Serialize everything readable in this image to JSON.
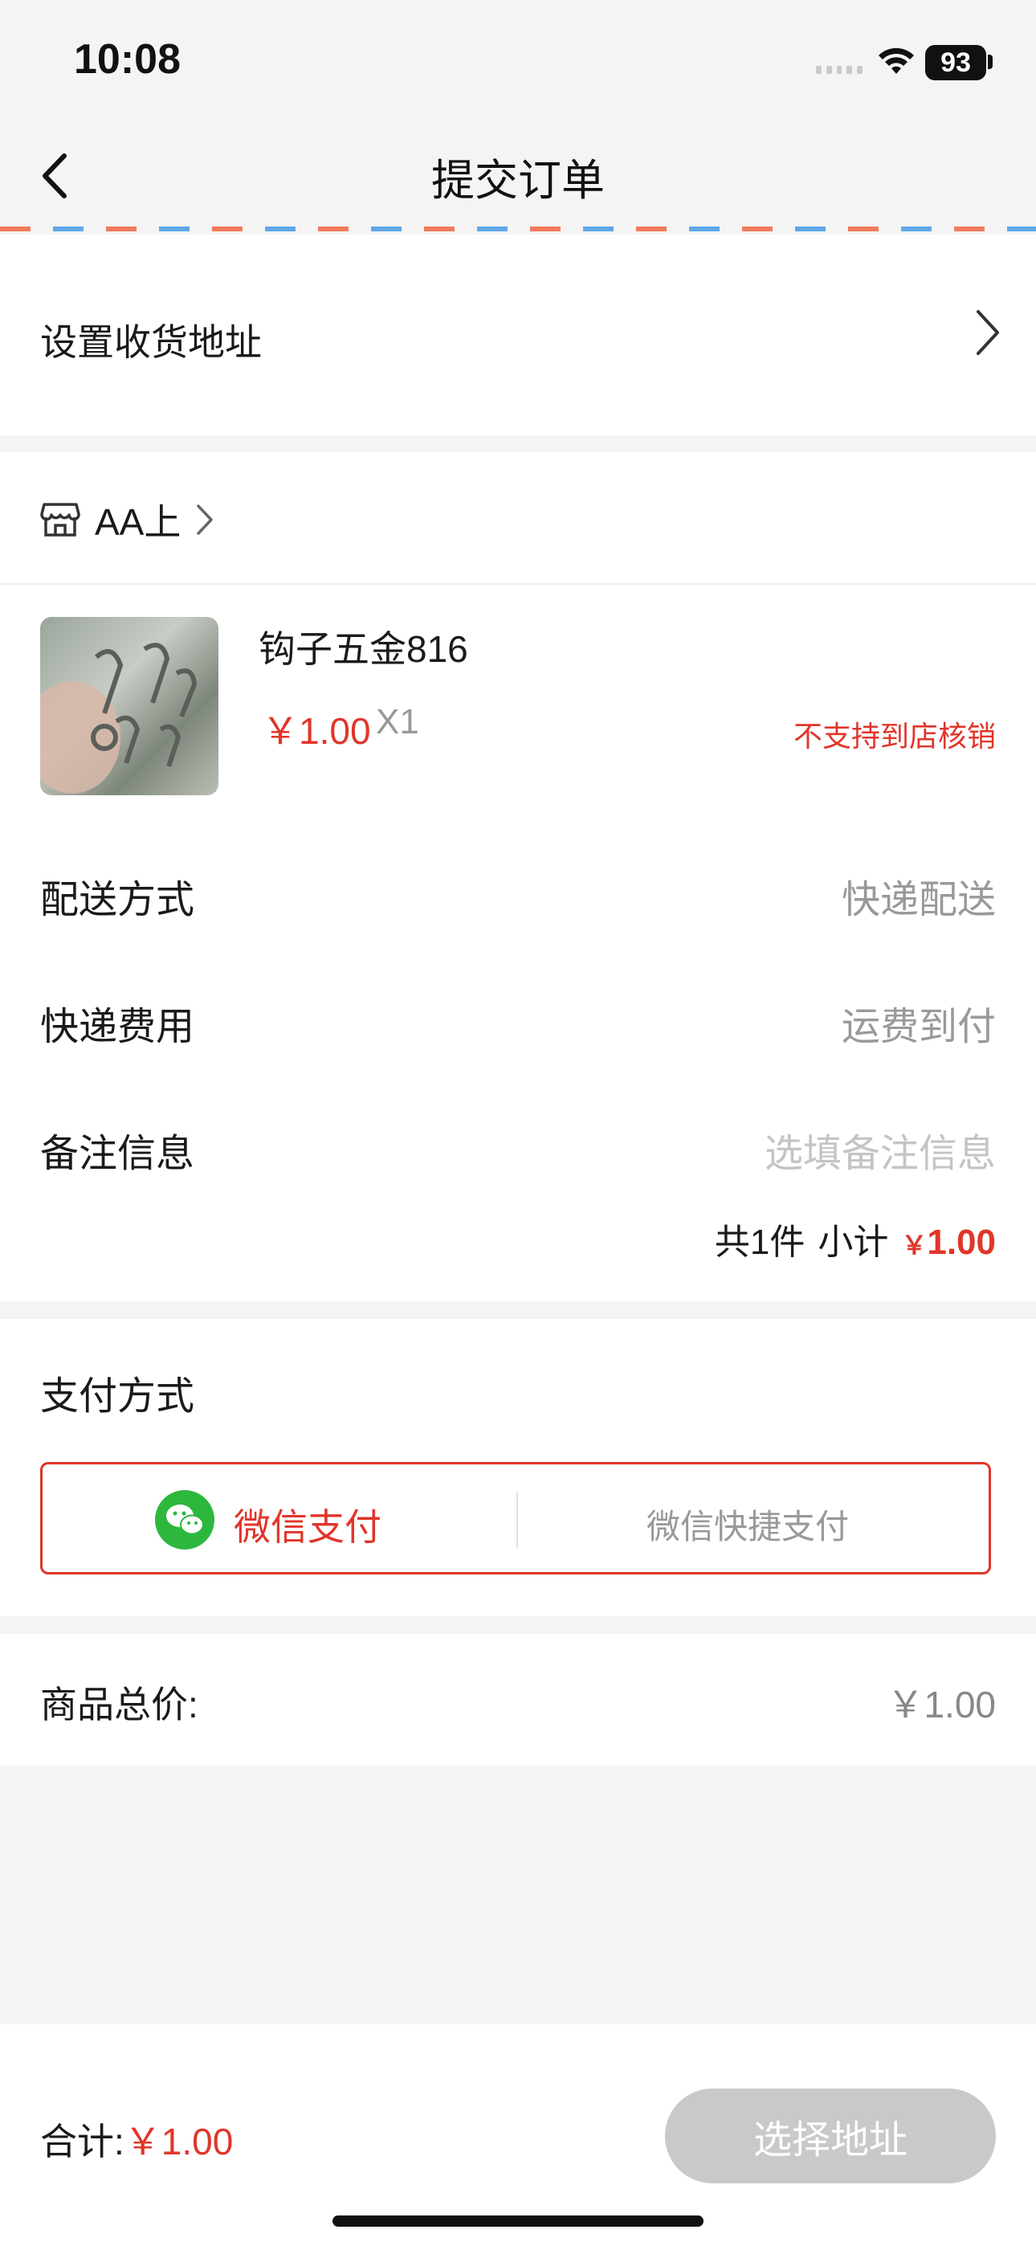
{
  "status_bar": {
    "time": "10:08",
    "battery": "93"
  },
  "nav": {
    "title": "提交订单"
  },
  "address": {
    "label": "设置收货地址"
  },
  "shop": {
    "name": "AA上",
    "product": {
      "name": "钩子五金816",
      "price": "￥1.00",
      "qty": "X1",
      "note": "不支持到店核销"
    }
  },
  "rows": [
    {
      "label": "配送方式",
      "value": "快递配送",
      "placeholder": false
    },
    {
      "label": "快递费用",
      "value": "运费到付",
      "placeholder": false
    },
    {
      "label": "备注信息",
      "value": "选填备注信息",
      "placeholder": true
    }
  ],
  "subtotal": {
    "count_text": "共1件",
    "label": "小计",
    "currency": "￥",
    "amount": "1.00"
  },
  "payment": {
    "label": "支付方式",
    "wechat": "微信支付",
    "wechat_fast": "微信快捷支付"
  },
  "total": {
    "label": "商品总价:",
    "value": "￥1.00"
  },
  "footer": {
    "sum_label": "合计:",
    "sum_value": "￥1.00",
    "button": "选择地址"
  }
}
